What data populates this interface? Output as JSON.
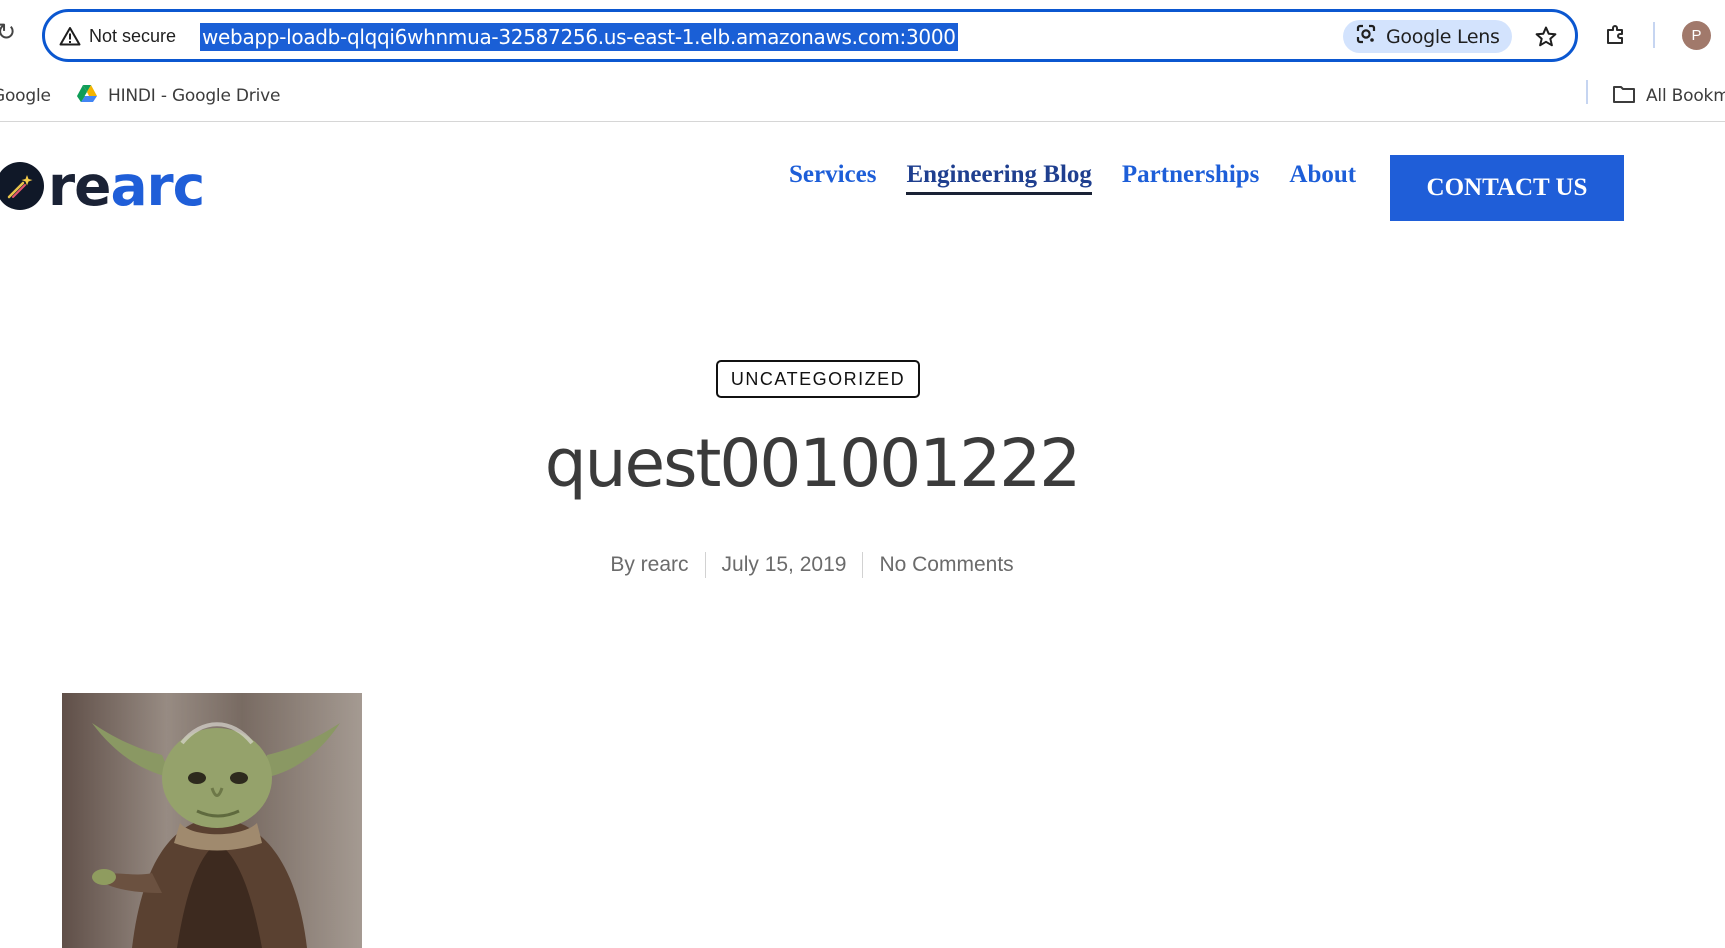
{
  "browser": {
    "security_label": "Not secure",
    "url": "webapp-loadb-qlqqi6whnmua-32587256.us-east-1.elb.amazonaws.com:3000",
    "lens_label": "Google Lens",
    "avatar_initial": "P",
    "accent_color": "#0b57d0"
  },
  "bookmarks": {
    "items": [
      {
        "label": "Google",
        "icon": "google-icon"
      },
      {
        "label": "HINDI - Google Drive",
        "icon": "google-drive-icon"
      }
    ],
    "all_bookmarks_label": "All Bookmarks"
  },
  "site": {
    "logo_text_a": "re",
    "logo_text_b": "arc",
    "brand_color": "#1f5ed8",
    "nav": [
      {
        "label": "Services"
      },
      {
        "label": "Engineering Blog",
        "active": true
      },
      {
        "label": "Partnerships"
      },
      {
        "label": "About"
      }
    ],
    "contact_label": "CONTACT US"
  },
  "post": {
    "category": "UNCATEGORIZED",
    "title": "quest001001222",
    "author": "By rearc",
    "date": "July 15, 2019",
    "comments": "No Comments",
    "image_icon": "yoda-photo"
  }
}
